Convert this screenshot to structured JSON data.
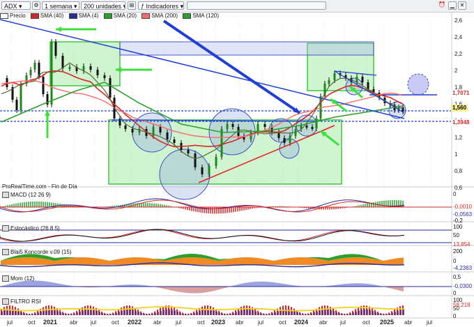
{
  "toolbar": {
    "symbol": "ADX",
    "period": "1 semana",
    "units": "200 unidades",
    "indicators_label": "Indicadores"
  },
  "legend": {
    "items": [
      {
        "label": "Precio",
        "color": "#ffffff"
      },
      {
        "label": "SMA (40)",
        "color": "#d62728"
      },
      {
        "label": "SMA (4)",
        "color": "#2a2a9a"
      },
      {
        "label": "SMA (20)",
        "color": "#2ca02c"
      },
      {
        "label": "SMA (200)",
        "color": "#ff6a6a"
      },
      {
        "label": "SMA (120)",
        "color": "#2ca02c"
      }
    ]
  },
  "y_axis": {
    "labels": [
      "2,6",
      "2,4",
      "2,2",
      "2",
      "1,8",
      "1,6",
      "1,4",
      "1,2",
      "1",
      "0,8",
      "0,6"
    ]
  },
  "price_tags": [
    {
      "text": "1,7071",
      "color": "#d62728",
      "bg": "#ffffff"
    },
    {
      "text": "1,560",
      "color": "#000000",
      "bg": "#f5f08a"
    },
    {
      "text": "1,3948",
      "color": "#d62728",
      "bg": "#ffffff"
    }
  ],
  "source_label": "ProRealTime.com - Fin de Día",
  "indicators": [
    {
      "title": "MACD (12 26 9)",
      "axis": [
        "0",
        "-0,2"
      ],
      "values": [
        "-0,0010",
        "-0,0563"
      ]
    },
    {
      "title": "Estocástico (26 8 5)",
      "axis": [
        "100",
        "50"
      ],
      "values": [
        "13,854"
      ]
    },
    {
      "title": "Blai5 Koncorde v.09 (15)",
      "axis": [
        "200",
        "0"
      ],
      "values": [
        "-4,2363"
      ]
    },
    {
      "title": "Mom (12)",
      "axis": [
        "0,5",
        "0"
      ],
      "values": [
        "-0,0300"
      ]
    },
    {
      "title": "FILTRO RSI",
      "axis": [
        "100",
        "50",
        "0"
      ],
      "values": [
        "58,218"
      ]
    }
  ],
  "x_axis": {
    "labels": [
      {
        "text": "jul",
        "year": false
      },
      {
        "text": "oct",
        "year": false
      },
      {
        "text": "2021",
        "year": true
      },
      {
        "text": "abr",
        "year": false
      },
      {
        "text": "jul",
        "year": false
      },
      {
        "text": "oct",
        "year": false
      },
      {
        "text": "2022",
        "year": true
      },
      {
        "text": "abr",
        "year": false
      },
      {
        "text": "jul",
        "year": false
      },
      {
        "text": "oct",
        "year": false
      },
      {
        "text": "2023",
        "year": true
      },
      {
        "text": "abr",
        "year": false
      },
      {
        "text": "jul",
        "year": false
      },
      {
        "text": "oct",
        "year": false
      },
      {
        "text": "2024",
        "year": true
      },
      {
        "text": "abr",
        "year": false
      },
      {
        "text": "jul",
        "year": false
      },
      {
        "text": "oct",
        "year": false
      },
      {
        "text": "2025",
        "year": true
      },
      {
        "text": "abr",
        "year": false
      },
      {
        "text": "jul",
        "year": false
      }
    ]
  },
  "colors": {
    "candle_up": "#1a8a1a",
    "candle_down": "#111111",
    "green_box": "#3ec83e",
    "blue_line": "#1f3fd6",
    "red_line": "#e02020"
  }
}
